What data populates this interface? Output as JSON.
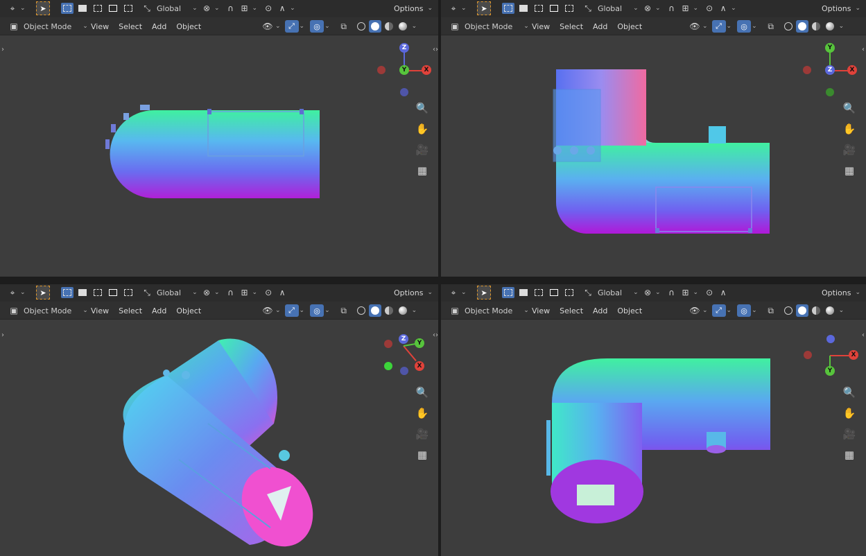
{
  "header": {
    "transform_orientation": "Global",
    "options_label": "Options",
    "mode_label": "Object Mode",
    "menu": [
      "View",
      "Select",
      "Add",
      "Object"
    ]
  },
  "icons": {
    "editor_type": "editor-type-icon",
    "select_tool": "select-box-tool-icon",
    "selection_modes": [
      "select-new-icon",
      "select-extend-icon",
      "select-subtract-icon",
      "select-invert-icon"
    ],
    "orientation": "transform-orientation-icon",
    "snap": "snap-icon",
    "proportional": "proportional-edit-icon",
    "visibility": "visibility-icon",
    "gizmo": "gizmo-icon",
    "overlays": "overlays-icon",
    "xray": "xray-icon",
    "shading": [
      "wireframe-icon",
      "solid-icon",
      "material-preview-icon",
      "rendered-icon"
    ],
    "nav": [
      "zoom-icon",
      "pan-hand-icon",
      "camera-icon",
      "grid-ortho-icon"
    ]
  },
  "viewports": [
    {
      "id": "top-left",
      "gizmo_labels": [
        "Z",
        "Y",
        "X"
      ]
    },
    {
      "id": "top-right",
      "gizmo_labels": [
        "Y",
        "Z",
        "X"
      ]
    },
    {
      "id": "bottom-left",
      "gizmo_labels": [
        "Z",
        "Y",
        "X"
      ]
    },
    {
      "id": "bottom-right",
      "gizmo_labels": [
        "X",
        "Y"
      ]
    }
  ],
  "colors": {
    "viewport_bg": "#3d3d3d",
    "header_bg": "#2c2c2c",
    "accent_blue": "#4772b3",
    "axis_x": "#e0423a",
    "axis_y": "#57c43c",
    "axis_z": "#5b68dc",
    "select_outline": "#e39a2d"
  }
}
